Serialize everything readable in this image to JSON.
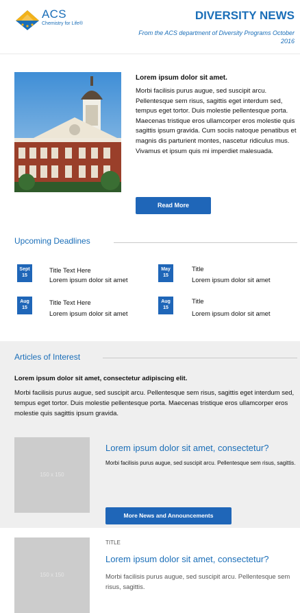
{
  "header": {
    "logo_text": "ACS",
    "logo_tagline": "Chemistry for Life®",
    "title": "DIVERSITY NEWS",
    "subtitle": "From the ACS department of Diversity Programs October 2016"
  },
  "hero": {
    "title": "Lorem ipsum dolor sit amet.",
    "body": "Morbi facilisis purus augue, sed suscipit arcu. Pellentesque sem risus, sagittis eget interdum sed, tempus eget tortor. Duis molestie pellentesque porta. Maecenas tristique eros ullamcorper eros molestie quis sagittis ipsum gravida. Cum sociis natoque penatibus et magnis dis parturient montes, nascetur ridiculus mus. Vivamus et ipsum quis mi imperdiet malesuada.",
    "button_label": "Read More"
  },
  "deadlines": {
    "heading": "Upcoming Deadlines",
    "items": [
      {
        "month": "Sept",
        "day": "15",
        "title": "Title Text Here",
        "desc": "Lorem ipsum dolor sit amet"
      },
      {
        "month": "May",
        "day": "15",
        "title": "Title",
        "desc": "Lorem ipsum dolor sit amet"
      },
      {
        "month": "Aug",
        "day": "15",
        "title": "Title Text Here",
        "desc": "Lorem ipsum dolor sit amet"
      },
      {
        "month": "Aug",
        "day": "15",
        "title": "Title",
        "desc": "Lorem ipsum dolor sit amet"
      }
    ]
  },
  "articles": {
    "heading": "Articles of Interest",
    "bold_line": "Lorem ipsum dolor sit amet, consectetur adipiscing elit.",
    "body": "Morbi facilisis purus augue, sed suscipit arcu. Pellentesque sem risus, sagittis eget interdum sed, tempus eget tortor. Duis molestie pellentesque porta. Maecenas tristique eros ullamcorper eros molestie quis sagittis ipsum gravida.",
    "card1": {
      "placeholder": "150 x 150",
      "title": "Lorem ipsum dolor sit amet, consectetur?",
      "body": "Morbi facilisis purus augue, sed suscipit arcu. Pellentesque sem risus, sagittis.",
      "button_label": "More News and Announcements"
    }
  },
  "card2": {
    "label": "TITLE",
    "placeholder": "150 x 150",
    "title": "Lorem ipsum dolor sit amet, consectetur?",
    "body": "Morbi facilisis purus augue, sed suscipit arcu. Pellentesque sem risus, sagittis."
  },
  "colors": {
    "brand_blue": "#1a6eb8",
    "button_blue": "#1f66b8",
    "logo_yellow": "#f2b21b",
    "section_gray": "#efefef",
    "placeholder_gray": "#cccccc"
  },
  "icons": {
    "logo": "acs-hexagon-logo-icon"
  }
}
